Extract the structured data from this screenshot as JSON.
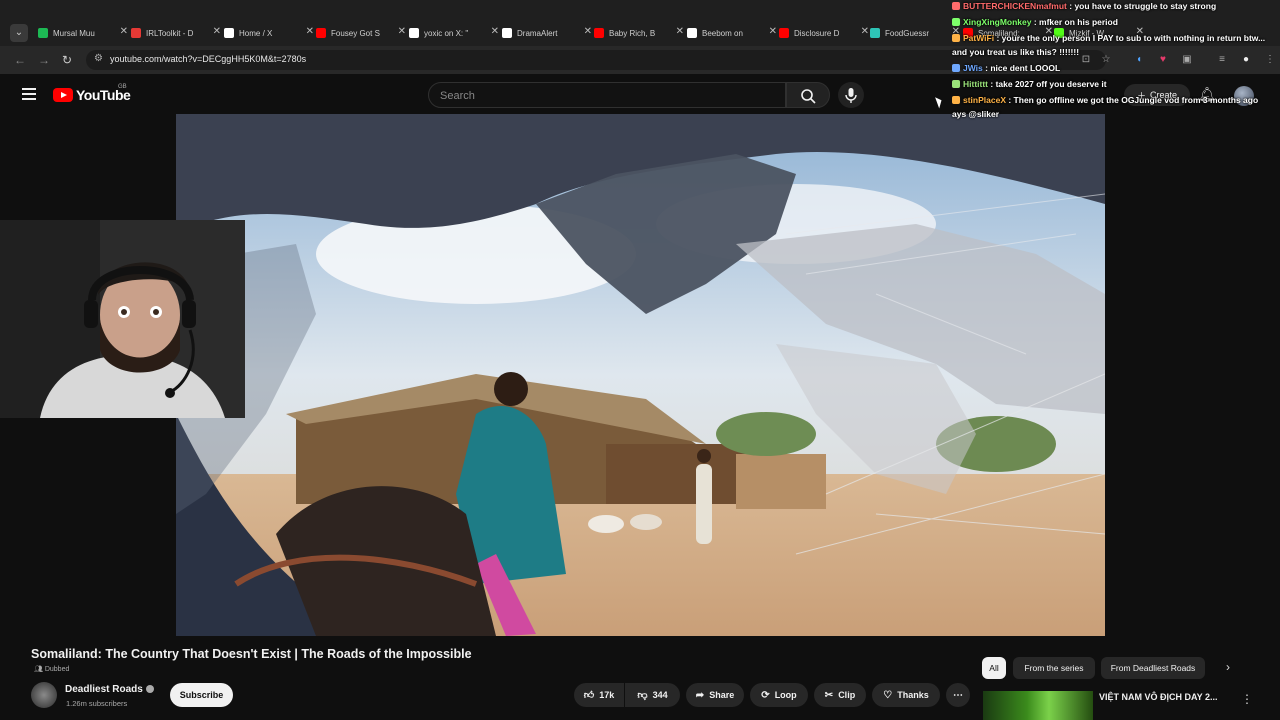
{
  "browser": {
    "tabs": [
      {
        "label": "Mursal Muu",
        "color": "#1db954"
      },
      {
        "label": "IRLToolkit - D",
        "color": "#e53935"
      },
      {
        "label": "Home / X",
        "color": "#ffffff"
      },
      {
        "label": "Fousey Got S",
        "color": "#ff0000"
      },
      {
        "label": "yoxic on X: \"",
        "color": "#ffffff"
      },
      {
        "label": "DramaAlert",
        "color": "#ffffff"
      },
      {
        "label": "Baby Rich, B",
        "color": "#ff0000"
      },
      {
        "label": "Beebom on",
        "color": "#ffffff"
      },
      {
        "label": "Disclosure D",
        "color": "#ff0000"
      },
      {
        "label": "FoodGuessr",
        "color": "#2ec4b6"
      },
      {
        "label": "Somaliland:",
        "color": "#ff0000"
      },
      {
        "label": "Mizkif - W",
        "color": "#53fc18"
      }
    ],
    "url": "youtube.com/watch?v=DECggHH5K0M&t=2780s"
  },
  "youtube": {
    "logo_text": "YouTube",
    "region": "GB",
    "search_placeholder": "Search",
    "create_label": "Create"
  },
  "chat": [
    {
      "user": "BUTTERCHICKENmafmut",
      "text": " : you have to struggle to stay strong",
      "color": "#ff6b6b"
    },
    {
      "user": "XingXingMonkey",
      "text": " : mfker on his period",
      "color": "#7dff6a"
    },
    {
      "user": "PatWiFi",
      "text": " : youre the only person I PAY to sub to with nothing in return btw...",
      "color": "#ffb347"
    },
    {
      "user": "",
      "text": "and you treat us like this? !!!!!!!",
      "color": "#ffffff"
    },
    {
      "user": "JWis",
      "text": " : nice dent LOOOL",
      "color": "#6fa8ff"
    },
    {
      "user": "Hittittt",
      "text": " : take 2027 off you deserve it",
      "color": "#9be37a"
    },
    {
      "user": "stinPlaceX",
      "text": " : Then go offline we got the OGJungle vod from 3 months ago",
      "color": "#ffb347"
    },
    {
      "user": "",
      "text": "ays @sliker",
      "color": "#ffffff"
    }
  ],
  "video": {
    "title": "Somaliland: The Country That Doesn't Exist | The Roads of the Impossible",
    "dubbed": "Dubbed",
    "channel": "Deadliest Roads",
    "subscribers": "1.26m subscribers",
    "subscribe_label": "Subscribe",
    "likes": "17k",
    "dislikes": "344",
    "share_label": "Share",
    "loop_label": "Loop",
    "clip_label": "Clip",
    "thanks_label": "Thanks"
  },
  "chips": [
    "All",
    "From the series",
    "From Deadliest Roads"
  ],
  "recommended": {
    "title": "VIỆT NAM VÔ ĐỊCH DAY 2..."
  }
}
